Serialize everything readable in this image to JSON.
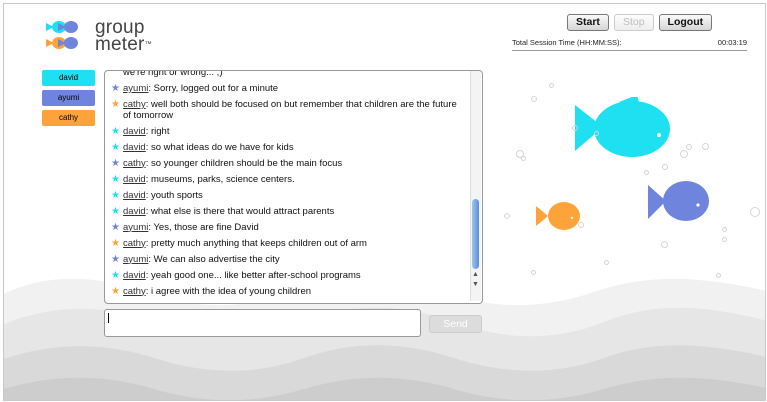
{
  "app": {
    "logo_line1": "group",
    "logo_line2": "meter",
    "logo_tm": "™"
  },
  "controls": {
    "start": "Start",
    "stop": "Stop",
    "logout": "Logout"
  },
  "session": {
    "label": "Total Session Time (HH:MM:SS):",
    "value": "00:03:19"
  },
  "users": [
    {
      "name": "david",
      "color": "#1fe0f0"
    },
    {
      "name": "ayumi",
      "color": "#6f85dd"
    },
    {
      "name": "cathy",
      "color": "#fda339"
    }
  ],
  "messages": [
    {
      "user": "",
      "text": "we're right or wrong... ;)",
      "star_color": ""
    },
    {
      "user": "ayumi",
      "text": ": Sorry, logged out for a minute",
      "star_color": "#6f85dd"
    },
    {
      "user": "cathy",
      "text": ": well both should be focused on but remember that children are the future of tomorrow",
      "star_color": "#fda339"
    },
    {
      "user": "david",
      "text": ": right",
      "star_color": "#1fe0f0"
    },
    {
      "user": "david",
      "text": ": so what ideas do we have for kids",
      "star_color": "#1fe0f0"
    },
    {
      "user": "cathy",
      "text": ": so younger children should be the main focus",
      "star_color": "#6f85dd"
    },
    {
      "user": "david",
      "text": ": museums, parks, science centers.",
      "star_color": "#1fe0f0"
    },
    {
      "user": "david",
      "text": ": youth sports",
      "star_color": "#1fe0f0"
    },
    {
      "user": "david",
      "text": ": what else is there that would attract parents",
      "star_color": "#1fe0f0"
    },
    {
      "user": "ayumi",
      "text": ": Yes, those are fine David",
      "star_color": "#6f85dd"
    },
    {
      "user": "cathy",
      "text": ": pretty much anything that keeps children out of arm",
      "star_color": "#fda339"
    },
    {
      "user": "ayumi",
      "text": ": We can also advertise the city",
      "star_color": "#6f85dd"
    },
    {
      "user": "david",
      "text": ": yeah good one... like better after-school programs",
      "star_color": "#1fe0f0"
    },
    {
      "user": "cathy",
      "text": ": i agree with the idea of young children",
      "star_color": "#fda339"
    }
  ],
  "compose": {
    "value": "",
    "send_label": "Send"
  },
  "icons": {
    "star": "star-icon",
    "fish": "fish-icon"
  },
  "colors": {
    "david": "#1fe0f0",
    "ayumi": "#6f85dd",
    "cathy": "#fda339",
    "wave": "#e9e9e9"
  }
}
